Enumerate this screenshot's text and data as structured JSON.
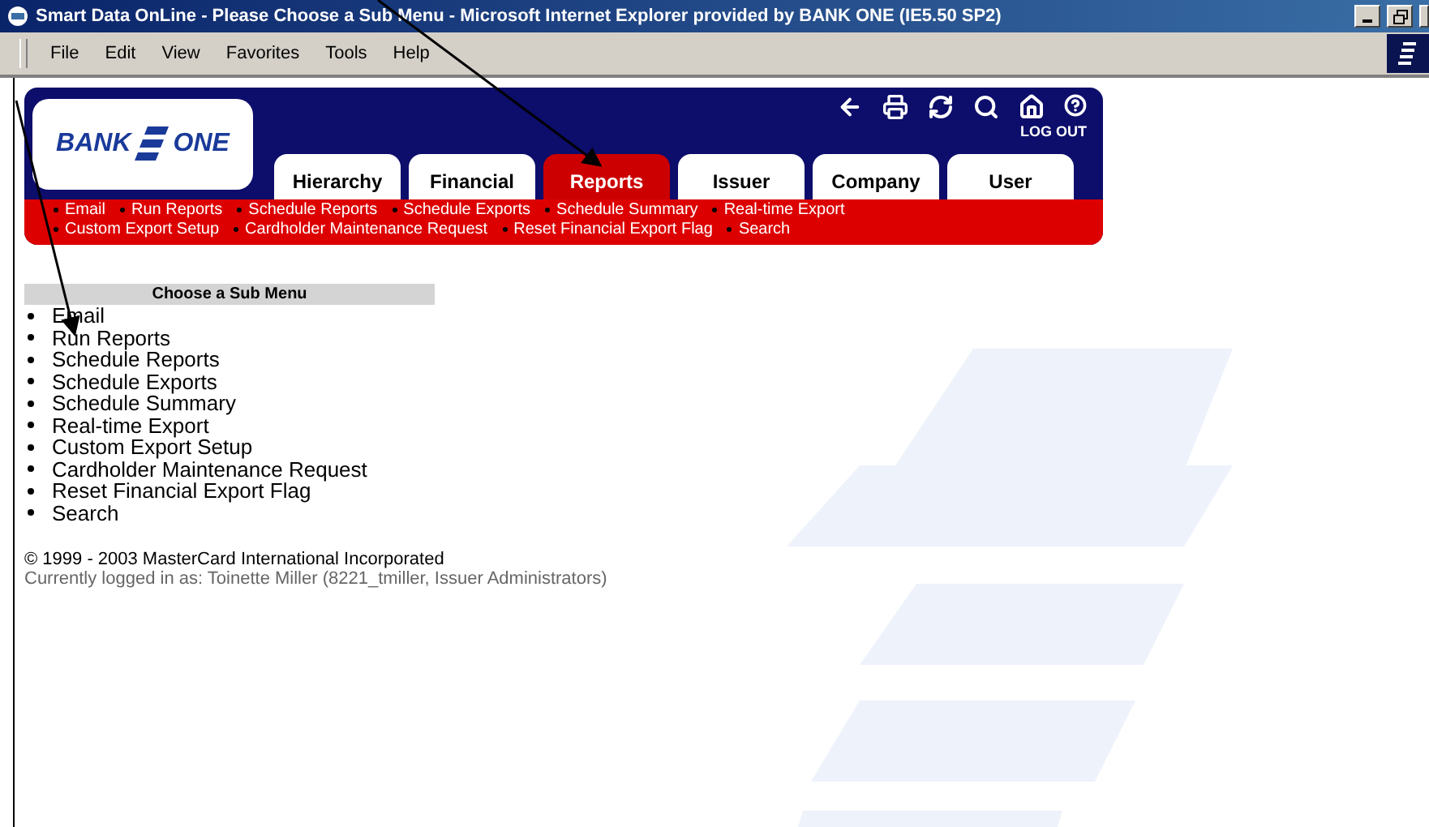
{
  "window": {
    "title": "Smart Data OnLine - Please Choose a Sub Menu - Microsoft Internet Explorer provided by BANK ONE (IE5.50 SP2)"
  },
  "menu_bar": [
    "File",
    "Edit",
    "View",
    "Favorites",
    "Tools",
    "Help"
  ],
  "header": {
    "logo": {
      "left": "BANK",
      "right": "ONE"
    },
    "log_out": "LOG OUT",
    "tabs": [
      {
        "label": "Hierarchy",
        "selected": false
      },
      {
        "label": "Financial",
        "selected": false
      },
      {
        "label": "Reports",
        "selected": true
      },
      {
        "label": "Issuer",
        "selected": false
      },
      {
        "label": "Company",
        "selected": false
      },
      {
        "label": "User",
        "selected": false
      }
    ],
    "sub_links": [
      [
        "Email",
        "Run Reports",
        "Schedule Reports",
        "Schedule Exports",
        "Schedule Summary",
        "Real-time Export"
      ],
      [
        "Custom Export Setup",
        "Cardholder Maintenance Request",
        "Reset Financial Export Flag",
        "Search"
      ]
    ]
  },
  "content": {
    "heading": "Choose a Sub Menu",
    "items": [
      "Email",
      "Run Reports",
      "Schedule Reports",
      "Schedule Exports",
      "Schedule Summary",
      "Real-time Export",
      "Custom Export Setup",
      "Cardholder Maintenance Request",
      "Reset Financial Export Flag",
      "Search"
    ],
    "copyright": "© 1999 - 2003 MasterCard International Incorporated",
    "logged_in": "Currently logged in as: Toinette Miller (8221_tmiller, Issuer Administrators)"
  }
}
